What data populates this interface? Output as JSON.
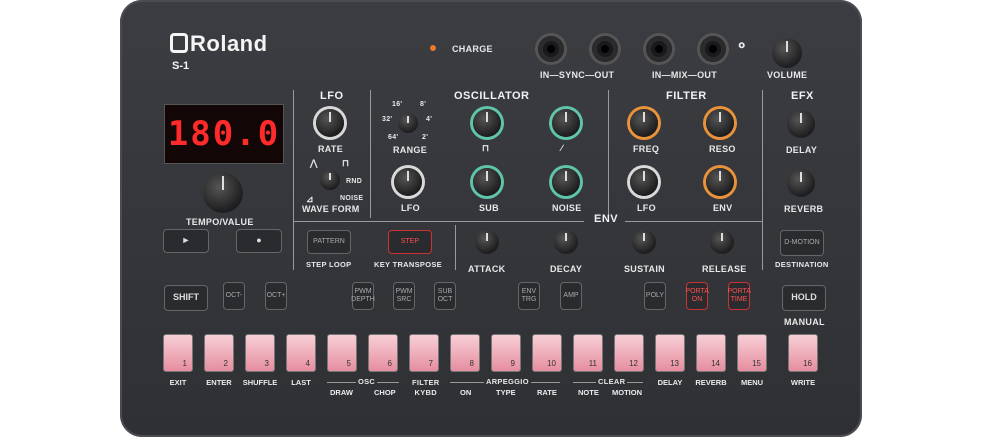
{
  "brand": "Roland",
  "model": "S-1",
  "charge_label": "CHARGE",
  "io": {
    "sync": "IN—SYNC—OUT",
    "mix": "IN—MIX—OUT",
    "volume": "VOLUME"
  },
  "display_value": "180.0",
  "tempo_label": "TEMPO/VALUE",
  "sections": {
    "lfo": "LFO",
    "oscillator": "OSCILLATOR",
    "filter": "FILTER",
    "efx": "EFX",
    "env": "ENV"
  },
  "lfo": {
    "rate": "RATE",
    "wave_form": "WAVE FORM",
    "rnd": "RND",
    "noise": "NOISE"
  },
  "osc": {
    "range": "RANGE",
    "r16": "16'",
    "r8": "8'",
    "r32": "32'",
    "r4": "4'",
    "r64": "64'",
    "r2": "2'",
    "lfo": "LFO",
    "sub": "SUB",
    "noise": "NOISE"
  },
  "filter": {
    "freq": "FREQ",
    "reso": "RESO",
    "lfo": "LFO",
    "env": "ENV"
  },
  "efx": {
    "delay": "DELAY",
    "reverb": "REVERB",
    "destination": "DESTINATION",
    "dmotion": "D-MOTION"
  },
  "env": {
    "attack": "ATTACK",
    "decay": "DECAY",
    "sustain": "SUSTAIN",
    "release": "RELEASE"
  },
  "buttons": {
    "pattern": "PATTERN",
    "step": "STEP",
    "step_loop": "STEP LOOP",
    "key_transpose": "KEY TRANSPOSE",
    "shift": "SHIFT",
    "oct_minus": "OCT-",
    "oct_plus": "OCT+",
    "pwm_depth": "PWM DEPTH",
    "pwm_src": "PWM SRC",
    "sub_oct": "SUB OCT",
    "env_trg": "ENV TRG",
    "amp": "AMP",
    "poly": "POLY",
    "porta_on": "PORTA ON",
    "porta_time": "PORTA TIME",
    "hold": "HOLD",
    "manual": "MANUAL",
    "play": "►",
    "rec": "●"
  },
  "steps": [
    "1",
    "2",
    "3",
    "4",
    "5",
    "6",
    "7",
    "8",
    "9",
    "10",
    "11",
    "12",
    "13",
    "14",
    "15",
    "16"
  ],
  "step_labels": [
    "EXIT",
    "ENTER",
    "SHUFFLE",
    "LAST",
    "",
    "",
    "",
    "",
    "",
    "",
    "",
    "",
    "DELAY",
    "REVERB",
    "MENU",
    "WRITE"
  ],
  "group_labels": {
    "osc": "OSC",
    "draw": "DRAW",
    "chop": "CHOP",
    "filter_kybd": "FILTER\nKYBD",
    "arpeggio": "ARPEGGIO",
    "on": "ON",
    "type": "TYPE",
    "rate": "RATE",
    "clear": "CLEAR",
    "note": "NOTE",
    "motion": "MOTION"
  },
  "colors": {
    "body": "#2e3034",
    "display_red": "#ff2a2a",
    "ring_green": "#5fc4a8",
    "ring_orange": "#e8923a",
    "pad_pink": "#f7cfd6",
    "charge_led": "#e8792a"
  }
}
